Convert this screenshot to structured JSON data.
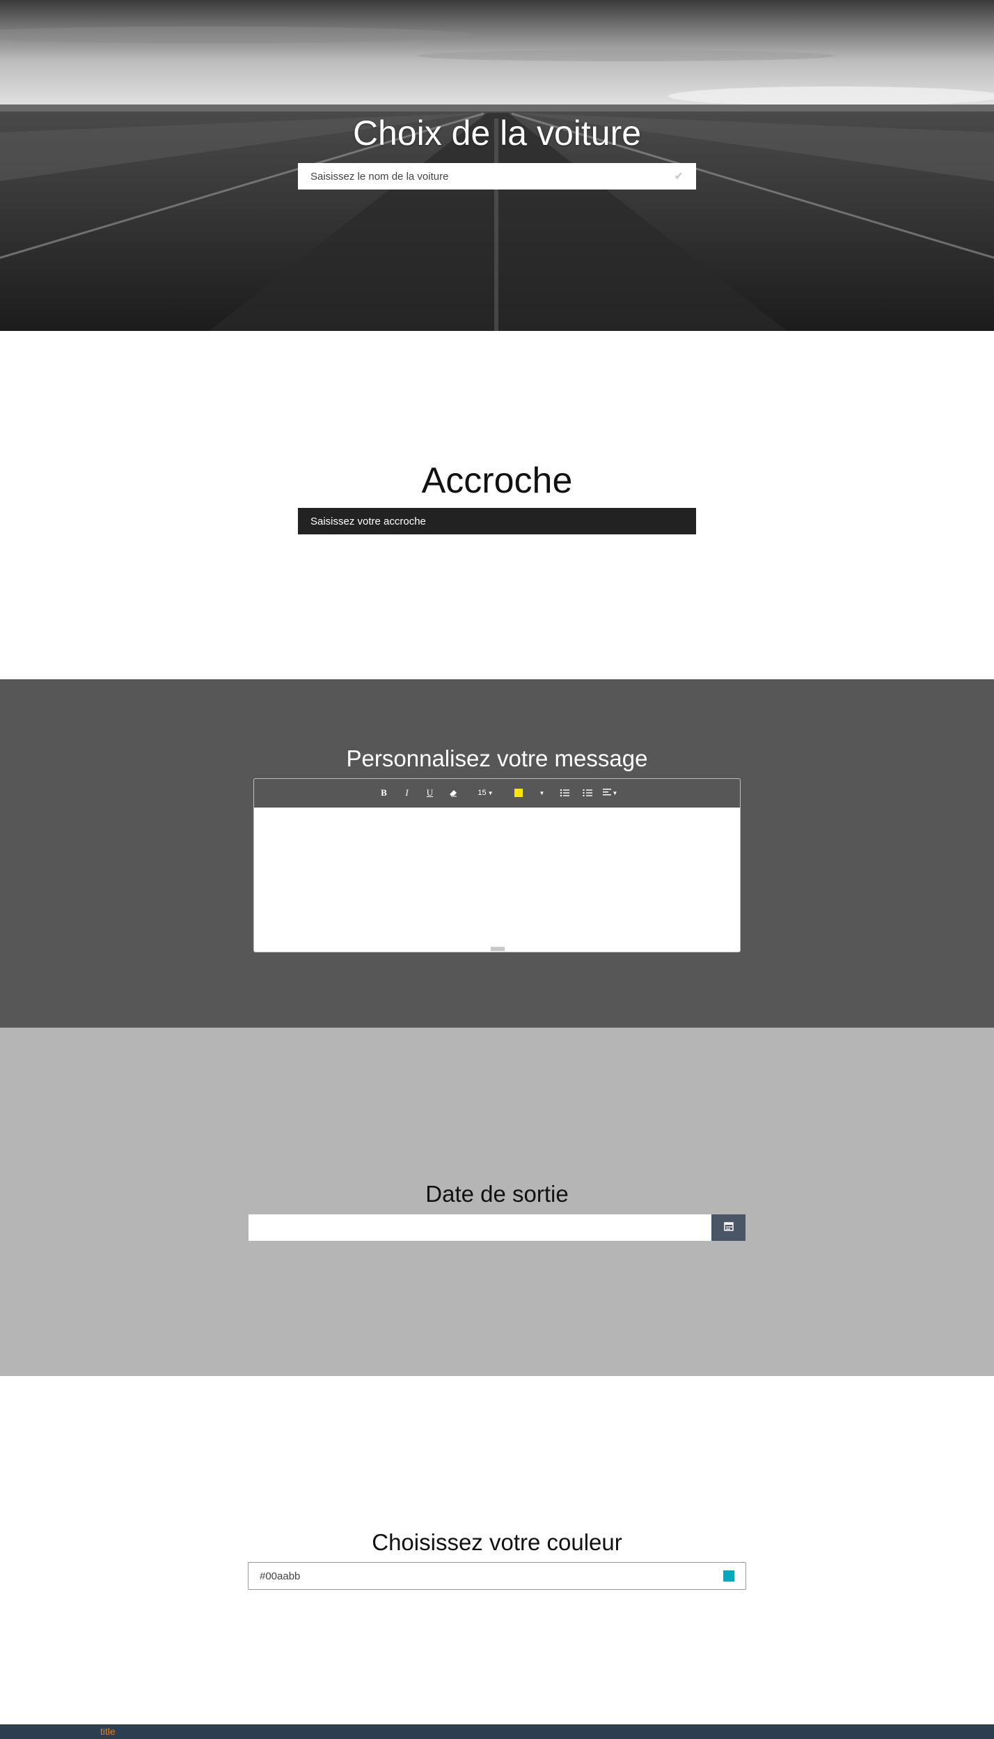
{
  "hero": {
    "title": "Choix de la voiture",
    "input_placeholder": "Saisissez le nom de la voiture",
    "input_icon": "check-icon"
  },
  "accroche": {
    "title": "Accroche",
    "input_placeholder": "Saisissez votre accroche"
  },
  "message": {
    "title": "Personnalisez votre message",
    "toolbar": {
      "bold_label": "B",
      "italic_label": "I",
      "underline_label": "U",
      "eraser_icon": "eraser-icon",
      "font_size": "15",
      "highlight_color": "#ffe600",
      "unordered_list_icon": "unordered-list-icon",
      "ordered_list_icon": "ordered-list-icon",
      "align_icon": "align-left-icon"
    }
  },
  "date": {
    "title": "Date de sortie",
    "value": "",
    "button_icon": "calendar-icon"
  },
  "color": {
    "title": "Choisissez votre couleur",
    "value": "#00aabb",
    "swatch_color": "#00aabb"
  },
  "footer": {
    "title": "title"
  }
}
